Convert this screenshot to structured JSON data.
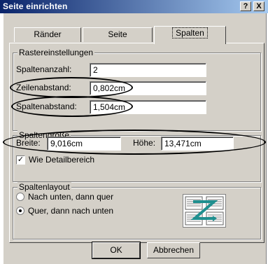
{
  "window": {
    "title": "Seite einrichten",
    "help_label": "?",
    "close_label": "X"
  },
  "tabs": [
    {
      "label": "Ränder",
      "active": false
    },
    {
      "label": "Seite",
      "active": false
    },
    {
      "label": "Spalten",
      "active": true
    }
  ],
  "raster": {
    "legend": "Rastereinstellungen",
    "count_label": "Spaltenanzahl:",
    "count_value": "2",
    "row_spacing_label": "Zeilenabstand:",
    "row_spacing_value": "0,802cm",
    "col_spacing_label": "Spaltenabstand:",
    "col_spacing_value": "1,504cm"
  },
  "size": {
    "legend": "Spaltengröße",
    "width_label": "Breite:",
    "width_value": "9,016cm",
    "height_label": "Höhe:",
    "height_value": "13,471cm",
    "detail_checkbox_label": "Wie Detailbereich",
    "detail_checked": true
  },
  "layout": {
    "legend": "Spaltenlayout",
    "option1_label": "Nach unten, dann quer",
    "option2_label": "Quer, dann nach unten",
    "selected": 2
  },
  "buttons": {
    "ok": "OK",
    "cancel": "Abbrechen"
  },
  "colors": {
    "dialog_bg": "#d4d0c8",
    "title_start": "#0a246a",
    "title_end": "#a6caf0",
    "z_arrow": "#1f8f8f"
  }
}
